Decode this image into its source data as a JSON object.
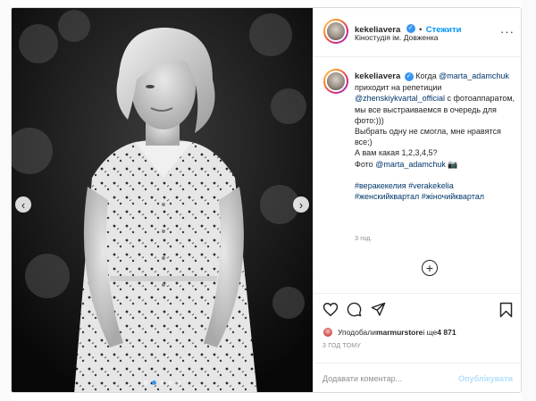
{
  "post": {
    "author": "kekeliavera",
    "follow_label": "Стежити",
    "separator": "•",
    "location": "Кіностудія ім. Довженка",
    "more_label": "···"
  },
  "caption": {
    "author": "kekeliavera",
    "text_1": " Когда ",
    "mention_1": "@marta_adamchuk",
    "text_2": " приходит на репетиции ",
    "mention_2": "@zhenskiykvartal_official",
    "text_3": " с фотоаппаратом, мы все выстраиваемся в очередь для фото:)))",
    "line_2": "Выбрать одну не смогла, мне нравятся все;)",
    "line_3": "А вам какая 1,2,3,4,5?",
    "line_4_prefix": "Фото ",
    "mention_3": "@marta_adamchuk",
    "line_4_suffix": " 📷",
    "tag_1": "#веракекелия",
    "tag_2": "#verakekelia",
    "tag_3": "#женскийквартал",
    "tag_4": "#жіночийквартал",
    "time": "3 год."
  },
  "load_more_label": "+",
  "likes": {
    "prefix": "Уподобали ",
    "user": "marmurstore",
    "middle": " і ще ",
    "count": "4 871"
  },
  "posted_ago": "3 ГОД ТОМУ",
  "comment_input": {
    "placeholder": "Додавати коментар...",
    "publish_label": "Опублікувати"
  },
  "carousel": {
    "total": 5,
    "current": 2,
    "prev_label": "‹",
    "next_label": "›"
  },
  "icons": [
    "heart-icon",
    "comment-icon",
    "share-icon",
    "bookmark-icon",
    "verified-icon",
    "plus-circle-icon"
  ],
  "colors": {
    "accent": "#0095f6",
    "mention": "#00376b",
    "muted": "#8e8e8e",
    "publish_disabled": "#b2dffc"
  }
}
